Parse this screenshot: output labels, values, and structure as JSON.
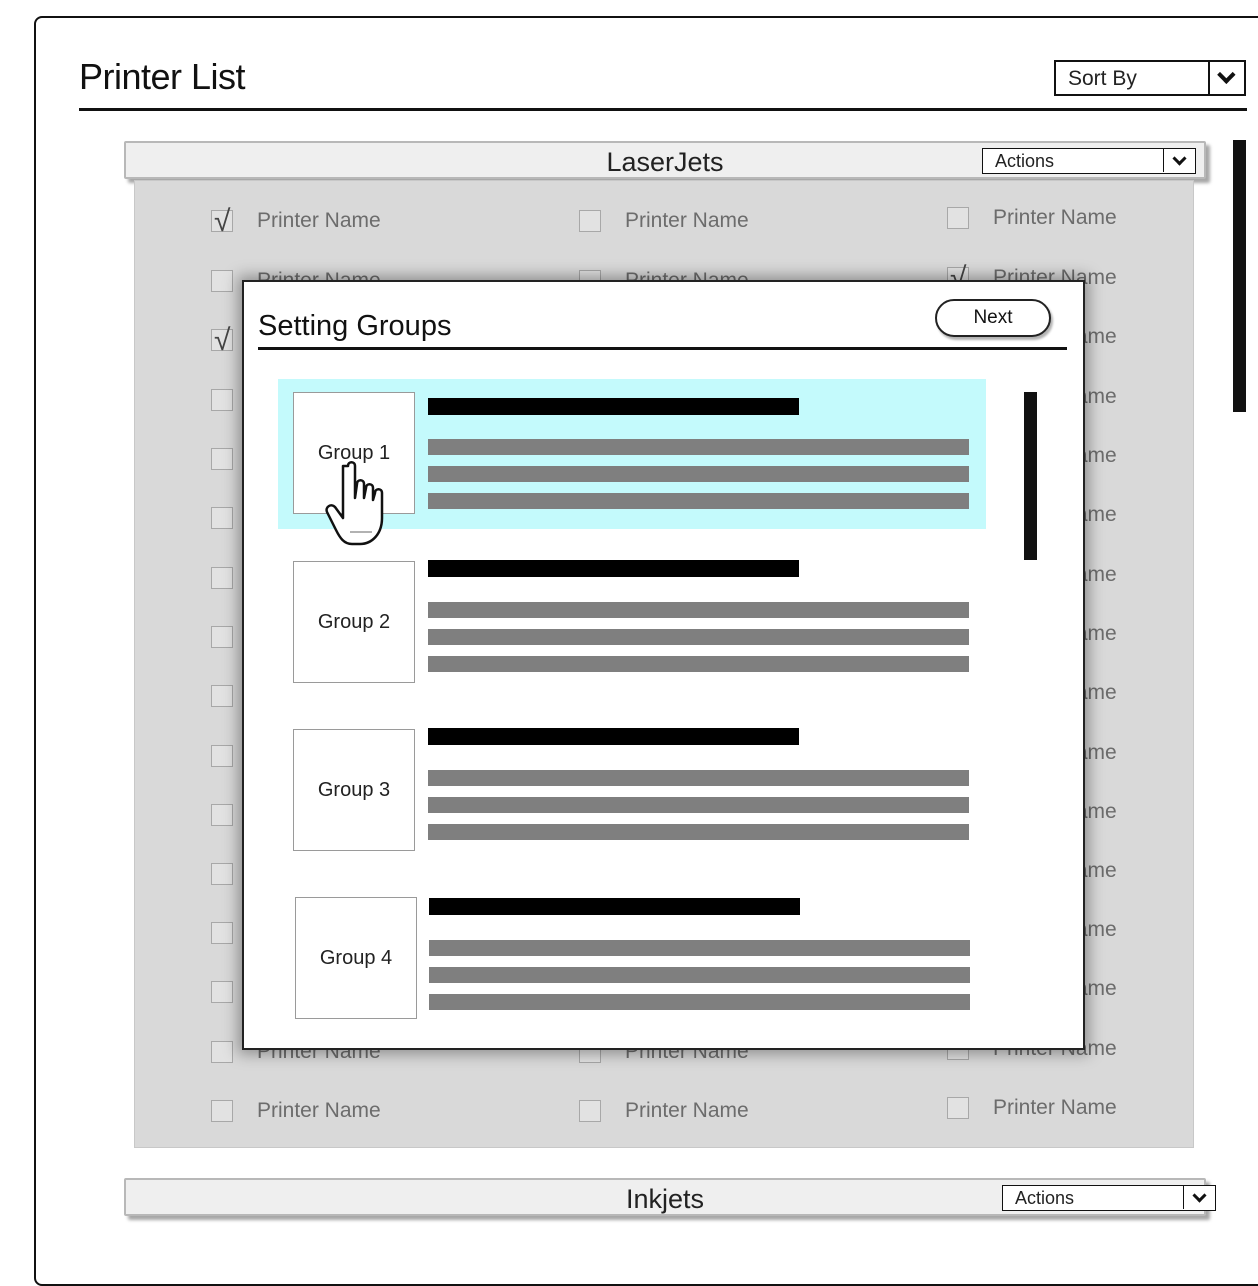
{
  "header": {
    "title": "Printer List",
    "sort_label": "Sort By",
    "sort_arrow_icon": "chevron-down-icon"
  },
  "sections": {
    "laserjets": {
      "title": "LaserJets",
      "actions_label": "Actions"
    },
    "inkjets": {
      "title": "Inkjets",
      "actions_label": "Actions"
    }
  },
  "printers": {
    "item_label": "Printer Name",
    "check_glyph": "√",
    "checked": [
      [
        true,
        false,
        false
      ],
      [
        false,
        false,
        true
      ],
      [
        true,
        false,
        false
      ],
      [
        false,
        false,
        false
      ],
      [
        false,
        false,
        false
      ],
      [
        false,
        false,
        false
      ],
      [
        false,
        false,
        false
      ],
      [
        false,
        false,
        false
      ],
      [
        false,
        false,
        false
      ],
      [
        false,
        false,
        false
      ],
      [
        false,
        false,
        false
      ],
      [
        false,
        false,
        false
      ],
      [
        false,
        false,
        false
      ],
      [
        false,
        false,
        false
      ],
      [
        false,
        false,
        false
      ],
      [
        false,
        false,
        false
      ]
    ],
    "col3_visible_suffix": "me"
  },
  "modal": {
    "title": "Setting Groups",
    "next_label": "Next",
    "groups": [
      {
        "label": "Group 1",
        "selected": true
      },
      {
        "label": "Group 2",
        "selected": false
      },
      {
        "label": "Group 3",
        "selected": false
      },
      {
        "label": "Group 4",
        "selected": false
      }
    ]
  },
  "colors": {
    "selected_row": "#c4fafc",
    "panel_bg": "#d9d9d9",
    "bar_dark": "#000000",
    "bar_gray": "#7f7f7f"
  },
  "icons": {
    "cursor": "hand-pointer-icon",
    "dropdown": "chevron-down-icon",
    "checkbox": "checkbox-icon"
  }
}
